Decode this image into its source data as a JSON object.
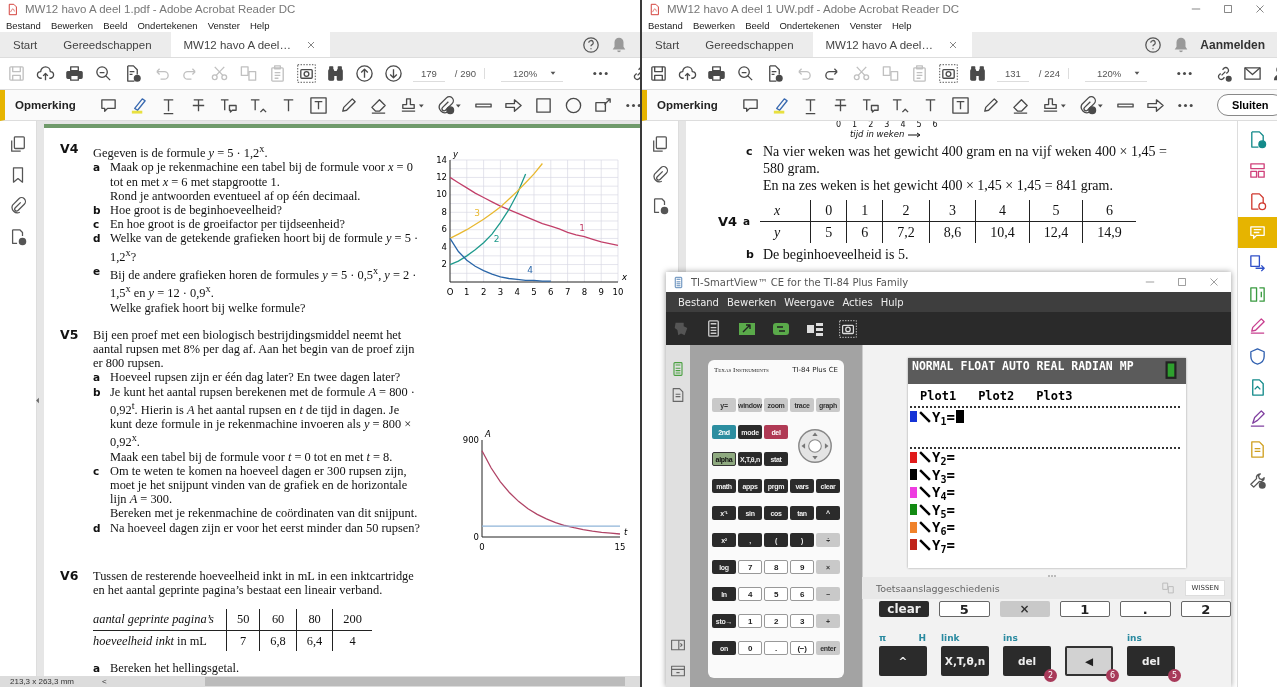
{
  "left_window": {
    "title": "MW12 havo A deel 1.pdf - Adobe Acrobat Reader DC",
    "menu": [
      "Bestand",
      "Bewerken",
      "Beeld",
      "Ondertekenen",
      "Venster",
      "Help"
    ],
    "tabs": [
      {
        "label": "Start",
        "selected": false
      },
      {
        "label": "Gereedschappen",
        "selected": false
      },
      {
        "label": "MW12 havo A deel…",
        "selected": true
      }
    ],
    "toolbar": {
      "tools": [
        {
          "kind": "save",
          "disabled": true
        },
        {
          "kind": "cloud-upload",
          "disabled": false
        },
        {
          "kind": "printer",
          "disabled": false
        },
        {
          "kind": "search",
          "disabled": false
        },
        {
          "kind": "document-sign",
          "disabled": false
        },
        {
          "kind": "undo",
          "disabled": true
        },
        {
          "kind": "redo",
          "disabled": true
        },
        {
          "kind": "scissors",
          "disabled": true
        },
        {
          "kind": "pages",
          "disabled": true
        },
        {
          "kind": "clipboard",
          "disabled": true
        },
        {
          "kind": "camera",
          "disabled": false
        },
        {
          "kind": "binoculars",
          "disabled": false
        },
        {
          "kind": "arrow-up-circle",
          "disabled": false
        },
        {
          "kind": "arrow-down-circle",
          "disabled": false
        }
      ],
      "page": "179",
      "page_count": "/ 290",
      "zoom": "120%",
      "end_tools": [
        {
          "kind": "more",
          "disabled": false
        },
        {
          "kind": "link",
          "disabled": false
        }
      ]
    },
    "comment_toolbar": {
      "label": "Opmerking",
      "tools": [
        {
          "kind": "speech-bubble"
        },
        {
          "kind": "highlighter"
        },
        {
          "kind": "underline-text"
        },
        {
          "kind": "strikethrough-text"
        },
        {
          "kind": "text-comment"
        },
        {
          "kind": "insert-text"
        },
        {
          "kind": "text"
        },
        {
          "kind": "text-box"
        },
        {
          "kind": "pencil"
        },
        {
          "kind": "eraser"
        },
        {
          "kind": "stamp"
        },
        {
          "kind": "paperclip"
        },
        {
          "kind": "line"
        },
        {
          "kind": "arrow-right"
        },
        {
          "kind": "rectangle"
        },
        {
          "kind": "circle"
        },
        {
          "kind": "callout"
        },
        {
          "kind": "more"
        }
      ]
    },
    "rail": [
      {
        "kind": "copy-pages"
      },
      {
        "kind": "bookmark"
      },
      {
        "kind": "paperclip-plain"
      },
      {
        "kind": "document-lock"
      }
    ],
    "document": {
      "exercises": [
        {
          "label": "V4",
          "intro": "Gegeven is de formule *y* = 5 · 1,2$^{x}$.",
          "items": [
            {
              "letter": "a",
              "paragraphs": [
                "Maak op je rekenmachine een tabel bij de formule voor *x* = 0 tot en met *x* = 6 met stapgrootte 1.",
                "Rond je antwoorden eventueel af op één decimaal."
              ]
            },
            {
              "letter": "b",
              "paragraphs": [
                "Hoe groot is de beginhoeveelheid?"
              ]
            },
            {
              "letter": "c",
              "paragraphs": [
                "En hoe groot is de groeifactor per tijdseenheid?"
              ]
            },
            {
              "letter": "d",
              "paragraphs": [
                "Welke van de getekende grafieken hoort bij de formule *y* = 5 · 1,2$^{x}$?"
              ]
            },
            {
              "letter": "e",
              "paragraphs": [
                "Bij de andere grafieken horen de formules *y* = 5 · 0,5$^{x}$, *y* = 2 · 1,5$^{x}$ en *y* = 12 · 0,9$^{x}$.",
                "Welke grafiek hoort bij welke formule?"
              ]
            }
          ],
          "chart_data": {
            "type": "line",
            "grid": true,
            "xlabel": "x",
            "ylabel": "y",
            "x": [
              0,
              0.5,
              1,
              1.5,
              2,
              2.5,
              3,
              3.5,
              4,
              4.5,
              5,
              5.5,
              6,
              6.5,
              7,
              7.5,
              8,
              8.5,
              9,
              9.5,
              10
            ],
            "xlim": [
              0,
              10
            ],
            "ylim": [
              0,
              14
            ],
            "xticks": [
              {
                "value": 0,
                "label": "O"
              },
              1,
              2,
              3,
              4,
              5,
              6,
              7,
              8,
              9,
              10
            ],
            "yticks": [
              2,
              4,
              6,
              8,
              10,
              12,
              14
            ],
            "series": [
              {
                "name": "1",
                "color": "#c2406a",
                "values": [
                  12,
                  11.4,
                  10.8,
                  10.2,
                  9.7,
                  9.2,
                  8.7,
                  8.3,
                  7.9,
                  7.5,
                  7.1,
                  6.7,
                  6.4,
                  6.1,
                  5.7,
                  5.4,
                  5.2,
                  4.9,
                  4.6,
                  4.4,
                  4.2
                ]
              },
              {
                "name": "2",
                "color": "#1f9a8c",
                "values": [
                  2,
                  2.4,
                  3,
                  3.7,
                  4.5,
                  5.5,
                  6.8,
                  8.3,
                  10.1,
                  12.4,
                  null,
                  null,
                  null,
                  null,
                  null,
                  null,
                  null,
                  null,
                  null,
                  null,
                  null
                ]
              },
              {
                "name": "3",
                "color": "#e8b830",
                "values": [
                  5,
                  5.5,
                  6,
                  6.6,
                  7.2,
                  7.9,
                  8.6,
                  9.5,
                  10.4,
                  11.4,
                  12.4,
                  13.6,
                  null,
                  null,
                  null,
                  null,
                  null,
                  null,
                  null,
                  null,
                  null
                ]
              },
              {
                "name": "4",
                "color": "#2a66a8",
                "values": [
                  5,
                  3.5,
                  2.5,
                  1.8,
                  1.3,
                  0.9,
                  0.6,
                  0.4,
                  0.3,
                  0.2,
                  0.2,
                  0.1,
                  0.1,
                  null,
                  null,
                  null,
                  null,
                  null,
                  null,
                  null,
                  null
                ]
              }
            ]
          }
        },
        {
          "label": "V5",
          "intro": "Bij een proef met een biologisch bestrijdingsmiddel neemt het aantal rupsen met 8% per dag af. Aan het begin van de proef zijn er 800 rupsen.",
          "items": [
            {
              "letter": "a",
              "paragraphs": [
                "Hoeveel rupsen zijn er één dag later? En twee dagen later?"
              ]
            },
            {
              "letter": "b",
              "paragraphs": [
                "Je kunt het aantal rupsen berekenen met de formule *A* = 800 · 0,92$^{t}$. Hierin is *A* het aantal rupsen en *t* de tijd in dagen. Je kunt deze formule in je rekenmachine invoeren als *y* = 800 × 0,92$^{x}$.",
                "Maak een tabel bij de formule voor *t* = 0 tot en met *t* = 8."
              ]
            },
            {
              "letter": "c",
              "paragraphs": [
                "Om te weten te komen na hoeveel dagen er 300 rupsen zijn, moet je het snijpunt vinden van de grafiek en de horizontale lijn *A* = 300.",
                "Bereken met je rekenmachine de coördinaten van dit snijpunt."
              ]
            },
            {
              "letter": "d",
              "paragraphs": [
                "Na hoeveel dagen zijn er voor het eerst minder dan 50 rupsen?"
              ]
            }
          ],
          "chart_data": {
            "type": "line",
            "grid": false,
            "xlabel": "t",
            "ylabel": "A",
            "x": [
              0,
              1,
              2,
              3,
              4,
              5,
              6,
              7,
              8,
              9,
              10,
              11,
              12,
              13,
              14,
              15
            ],
            "xlim": [
              0,
              15
            ],
            "ylim": [
              0,
              900
            ],
            "xticks": [
              0,
              15
            ],
            "yticks": [
              0,
              900
            ],
            "series": [
              {
                "color": "#b04466",
                "values": [
                  800,
                  640,
                  512,
                  410,
                  328,
                  262,
                  210,
                  168,
                  134,
                  107,
                  86,
                  69,
                  55,
                  44,
                  35,
                  28
                ]
              },
              {
                "color": "#8fb4d8",
                "values": [
                  100,
                  100,
                  100,
                  100,
                  100,
                  100,
                  100,
                  100,
                  100,
                  100,
                  100,
                  100,
                  100,
                  100,
                  100,
                  100
                ]
              }
            ]
          }
        },
        {
          "label": "V6",
          "intro": "Tussen de resterende hoeveelheid inkt in mL in een inktcartridge en het aantal geprinte pagina’s bestaat een lineair verband.",
          "table": {
            "rows": [
              {
                "head": "aantal geprinte pagina’s",
                "italic": true,
                "cells": [
                  "50",
                  "60",
                  "80",
                  "200"
                ]
              },
              {
                "head": "*hoeveelheid inkt* in mL",
                "italic": false,
                "cells": [
                  "7",
                  "6,8",
                  "6,4",
                  "4"
                ]
              }
            ]
          },
          "items": [
            {
              "letter": "a",
              "paragraphs": [
                "Bereken het hellingsgetal."
              ]
            }
          ]
        }
      ]
    },
    "status_bar": {
      "size": "213,3 x 263,3 mm",
      "scroll_left": "<"
    }
  },
  "right_window": {
    "title": "MW12 havo A deel 1 UW.pdf - Adobe Acrobat Reader DC",
    "menu": [
      "Bestand",
      "Bewerken",
      "Beeld",
      "Ondertekenen",
      "Venster",
      "Help"
    ],
    "tabs": [
      {
        "label": "Start",
        "selected": false
      },
      {
        "label": "Gereedschappen",
        "selected": false
      },
      {
        "label": "MW12 havo A deel…",
        "selected": true
      }
    ],
    "sign_in": "Aanmelden",
    "toolbar": {
      "tools": [
        {
          "kind": "save",
          "disabled": false
        },
        {
          "kind": "cloud-upload",
          "disabled": false
        },
        {
          "kind": "printer",
          "disabled": false
        },
        {
          "kind": "search",
          "disabled": false
        },
        {
          "kind": "document-sign",
          "disabled": false
        },
        {
          "kind": "undo",
          "disabled": true
        },
        {
          "kind": "redo",
          "disabled": false
        },
        {
          "kind": "scissors",
          "disabled": true
        },
        {
          "kind": "pages",
          "disabled": true
        },
        {
          "kind": "clipboard",
          "disabled": true
        },
        {
          "kind": "camera",
          "disabled": false
        },
        {
          "kind": "binoculars",
          "disabled": false
        }
      ],
      "page": "131",
      "page_count": "/ 224",
      "zoom": "120%",
      "end_tools": [
        {
          "kind": "more",
          "disabled": false
        },
        {
          "kind": "link",
          "disabled": false
        },
        {
          "kind": "mail",
          "disabled": false
        },
        {
          "kind": "person-add",
          "disabled": false
        }
      ]
    },
    "comment_toolbar": {
      "label": "Opmerking",
      "tools": [
        {
          "kind": "speech-bubble"
        },
        {
          "kind": "highlighter"
        },
        {
          "kind": "underline-text"
        },
        {
          "kind": "strikethrough-text"
        },
        {
          "kind": "text-comment"
        },
        {
          "kind": "insert-text"
        },
        {
          "kind": "text"
        },
        {
          "kind": "text-box"
        },
        {
          "kind": "pencil"
        },
        {
          "kind": "eraser"
        },
        {
          "kind": "stamp"
        },
        {
          "kind": "paperclip"
        },
        {
          "kind": "line"
        },
        {
          "kind": "arrow-right"
        },
        {
          "kind": "more"
        }
      ],
      "close_button": "Sluiten"
    },
    "rail": [
      {
        "kind": "copy-pages"
      },
      {
        "kind": "paperclip-plain"
      },
      {
        "kind": "document-lock"
      }
    ],
    "document": {
      "axis_ticks": [
        "0",
        "1",
        "2",
        "3",
        "4",
        "5",
        "6"
      ],
      "axis_label": "tijd in weken",
      "answers": [
        {
          "letter": "c",
          "paragraphs": [
            "Na vier weken was het gewicht 400 gram en na vijf weken 400 × 1,45 = 580 gram.",
            "En na zes weken is het gewicht 400 × 1,45 × 1,45 = 841 gram."
          ]
        }
      ],
      "table": {
        "label": "V4",
        "letter": "a",
        "rows": [
          {
            "head": "x",
            "cells": [
              "0",
              "1",
              "2",
              "3",
              "4",
              "5",
              "6"
            ]
          },
          {
            "head": "y",
            "cells": [
              "5",
              "6",
              "7,2",
              "8,6",
              "10,4",
              "12,4",
              "14,9"
            ]
          }
        ]
      },
      "after": [
        {
          "letter": "b",
          "paragraphs": [
            "De beginhoeveelheid is 5."
          ]
        }
      ]
    },
    "side_panel": [
      {
        "kind": "document-plus",
        "selected": false
      },
      {
        "kind": "layout",
        "selected": false
      },
      {
        "kind": "document-add",
        "selected": false
      },
      {
        "kind": "comment",
        "selected": true
      },
      {
        "kind": "document-export",
        "selected": false
      },
      {
        "kind": "compress",
        "selected": false
      },
      {
        "kind": "signature",
        "selected": false
      },
      {
        "kind": "shield",
        "selected": false
      },
      {
        "kind": "document-send",
        "selected": false
      },
      {
        "kind": "pen",
        "selected": false
      },
      {
        "kind": "document",
        "selected": false
      },
      {
        "kind": "wrench",
        "selected": false
      }
    ]
  },
  "calculator_window": {
    "title": "TI-SmartView™ CE for the TI-84 Plus Family",
    "menu": [
      "Bestand",
      "Bewerken",
      "Weergave",
      "Acties",
      "Hulp"
    ],
    "calculator": {
      "brand": "Texas Instruments",
      "model": "TI-84 Plus CE",
      "keys": [
        {
          "label": "y=",
          "kind": "light"
        },
        {
          "label": "window",
          "kind": "light"
        },
        {
          "label": "zoom",
          "kind": "light"
        },
        {
          "label": "trace",
          "kind": "light"
        },
        {
          "label": "graph",
          "kind": "light"
        },
        {
          "label": "2nd",
          "kind": "teal"
        },
        {
          "label": "mode",
          "kind": "dark"
        },
        {
          "label": "del",
          "kind": "red"
        },
        {
          "label": "alpha",
          "kind": "green"
        },
        {
          "label": "X,T,θ,n",
          "kind": "dark"
        },
        {
          "label": "stat",
          "kind": "dark"
        },
        {
          "label": "math",
          "kind": "dark"
        },
        {
          "label": "apps",
          "kind": "dark"
        },
        {
          "label": "prgm",
          "kind": "dark"
        },
        {
          "label": "vars",
          "kind": "dark"
        },
        {
          "label": "clear",
          "kind": "dark"
        },
        {
          "label": "x⁻¹",
          "kind": "dark"
        },
        {
          "label": "sin",
          "kind": "dark"
        },
        {
          "label": "cos",
          "kind": "dark"
        },
        {
          "label": "tan",
          "kind": "dark"
        },
        {
          "label": "^",
          "kind": "dark"
        },
        {
          "label": "x²",
          "kind": "dark"
        },
        {
          "label": ",",
          "kind": "dark"
        },
        {
          "label": "(",
          "kind": "dark"
        },
        {
          "label": ")",
          "kind": "dark"
        },
        {
          "label": "÷",
          "kind": "light"
        },
        {
          "label": "log",
          "kind": "dark"
        },
        {
          "label": "7",
          "kind": "white"
        },
        {
          "label": "8",
          "kind": "white"
        },
        {
          "label": "9",
          "kind": "white"
        },
        {
          "label": "×",
          "kind": "light"
        },
        {
          "label": "ln",
          "kind": "dark"
        },
        {
          "label": "4",
          "kind": "white"
        },
        {
          "label": "5",
          "kind": "white"
        },
        {
          "label": "6",
          "kind": "white"
        },
        {
          "label": "−",
          "kind": "light"
        },
        {
          "label": "sto→",
          "kind": "dark"
        },
        {
          "label": "1",
          "kind": "white"
        },
        {
          "label": "2",
          "kind": "white"
        },
        {
          "label": "3",
          "kind": "white"
        },
        {
          "label": "+",
          "kind": "light"
        },
        {
          "label": "on",
          "kind": "dark"
        },
        {
          "label": "0",
          "kind": "white"
        },
        {
          "label": ".",
          "kind": "white"
        },
        {
          "label": "(−)",
          "kind": "white"
        },
        {
          "label": "enter",
          "kind": "light"
        }
      ]
    },
    "screen": {
      "status": "NORMAL FLOAT AUTO REAL RADIAN MP",
      "plots": [
        "Plot1",
        "Plot2",
        "Plot3"
      ],
      "functions": [
        {
          "label": "Y$_{1}$=",
          "color": "#1533d6",
          "selected": true
        },
        {
          "label": "Y$_{2}$=",
          "color": "#e01b1b",
          "selected": false
        },
        {
          "label": "Y$_{3}$=",
          "color": "#000000",
          "selected": false
        },
        {
          "label": "Y$_{4}$=",
          "color": "#ee3ce0",
          "selected": false
        },
        {
          "label": "Y$_{5}$=",
          "color": "#128a12",
          "selected": false
        },
        {
          "label": "Y$_{6}$=",
          "color": "#f0822a",
          "selected": false
        },
        {
          "label": "Y$_{7}$=",
          "color": "#c0241a",
          "selected": false
        }
      ]
    },
    "history": {
      "title": "Toetsaanslaggeschiedenis",
      "clear_button": "WISSEN",
      "previous_keys": [
        {
          "label": "clear",
          "kind": "dark"
        },
        {
          "label": "5",
          "kind": "white"
        },
        {
          "label": "×",
          "kind": "light"
        },
        {
          "label": "1",
          "kind": "white"
        },
        {
          "label": ".",
          "kind": "white"
        },
        {
          "label": "2",
          "kind": "white"
        }
      ],
      "keys": [
        {
          "label": "^",
          "kind": "dark",
          "above": [
            "π",
            "H"
          ]
        },
        {
          "label": "X,T,θ,n",
          "kind": "dark",
          "above": [
            "link"
          ]
        },
        {
          "label": "del",
          "kind": "dark",
          "above": [
            "ins"
          ],
          "count": "2"
        },
        {
          "label": "◀",
          "kind": "light",
          "count": "6"
        },
        {
          "label": "del",
          "kind": "dark",
          "above": [
            "ins"
          ],
          "count": "5"
        }
      ]
    }
  }
}
